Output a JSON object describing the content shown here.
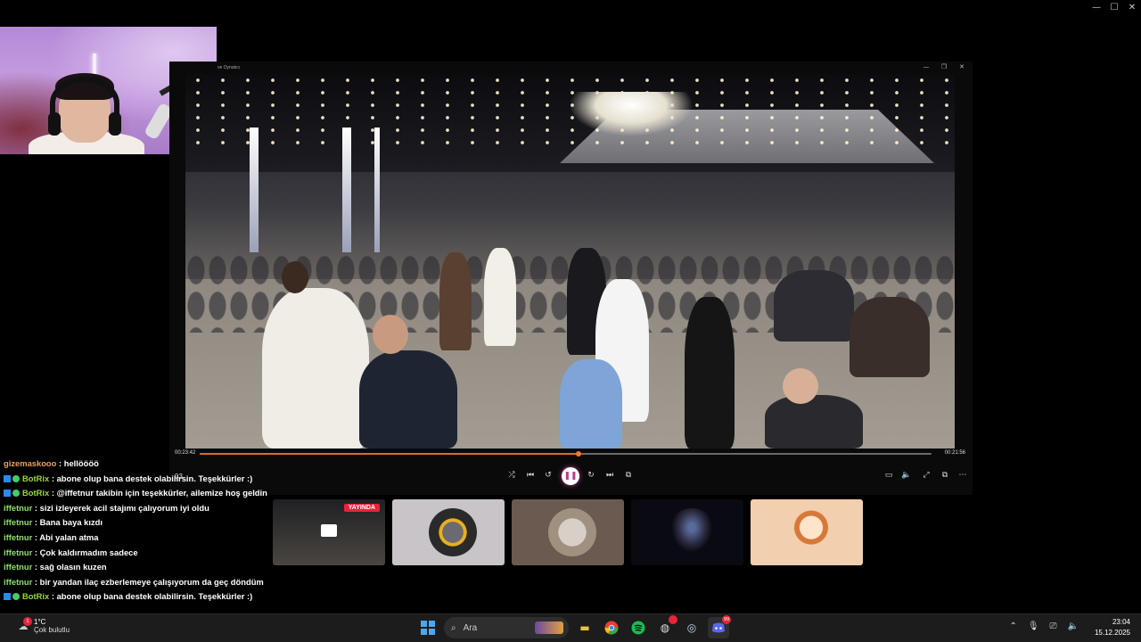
{
  "window": {
    "minimize": "—",
    "maximize": "☐",
    "close": "✕"
  },
  "player": {
    "title": "ve Oynatıcı",
    "controls": {
      "minimize": "—",
      "restore": "❐",
      "close": "✕"
    },
    "time_elapsed": "00:23:42",
    "time_remaining": "00:21:56",
    "progress": 0.518,
    "volume_label": "03",
    "buttons": {
      "shuffle": "⤮",
      "prev": "⏮",
      "rewind": "↺",
      "play_pause": "❚❚",
      "forward": "↻",
      "next": "⏭",
      "subtitles": "⧉",
      "miniplayer": "▭",
      "volume": "🔈",
      "fullscreen": "⤢",
      "pip": "⧉",
      "more": "⋯"
    }
  },
  "chat": {
    "messages": [
      {
        "user": "gizemaskooo",
        "type": "gz",
        "text": "hellöööö"
      },
      {
        "user": "BotRix",
        "type": "bot",
        "text": "abone olup bana destek olabilirsin. Teşekkürler :)"
      },
      {
        "user": "BotRix",
        "type": "bot",
        "text": "@iffetnur takibin için teşekkürler, ailemize hoş geldin"
      },
      {
        "user": "iffetnur",
        "type": "if",
        "text": "sizi izleyerek acil stajımı çalıyorum iyi oldu"
      },
      {
        "user": "iffetnur",
        "type": "if",
        "text": "Bana baya kızdı"
      },
      {
        "user": "iffetnur",
        "type": "if",
        "text": "Abi yalan atma"
      },
      {
        "user": "iffetnur",
        "type": "if",
        "text": "Çok kaldırmadım sadece"
      },
      {
        "user": "iffetnur",
        "type": "if",
        "text": "sağ olasın kuzen"
      },
      {
        "user": "iffetnur",
        "type": "if",
        "text": "bir yandan ilaç ezberlemeye çalışıyorum da geç döndüm"
      },
      {
        "user": "BotRix",
        "type": "bot",
        "text": "abone olup bana destek olabilirsin. Teşekkürler :)"
      }
    ]
  },
  "thumbnails": {
    "live_label": "YAYINDA",
    "colors": [
      "#2a2a2a",
      "#c8c4c8",
      "#6a5a50",
      "#0a0a12",
      "#f2cfae"
    ]
  },
  "taskbar": {
    "weather_temp": "1°C",
    "weather_cond": "Çok bulutlu",
    "search_placeholder": "Ara",
    "time": "23:04",
    "date": "15.12.2025",
    "weather_badge": "1",
    "discord_badge": "99"
  }
}
